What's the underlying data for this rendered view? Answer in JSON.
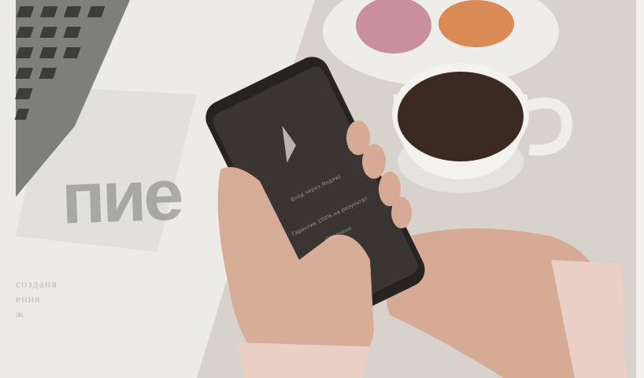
{
  "scene": {
    "description_alt": "",
    "background_text": {
      "word": "пие",
      "caption_lines": [
        "созданя",
        "ения",
        "ж"
      ]
    },
    "phone_screen": {
      "logo_icon": "triangle-logo-icon",
      "menu_item_1": "Вход через Яндекс",
      "menu_item_2": "Гарантия 100% на результат",
      "menu_item_3": "Оплачено"
    },
    "colors": {
      "laptop": "#8f8f8c",
      "paper": "#ecebe8",
      "coffee": "#3a2a22",
      "cup": "#f4f2ee",
      "phone_body": "#262321",
      "macaron_pink": "#c98f9c",
      "macaron_orange": "#d98a55",
      "skin": "#d6aa95"
    }
  }
}
